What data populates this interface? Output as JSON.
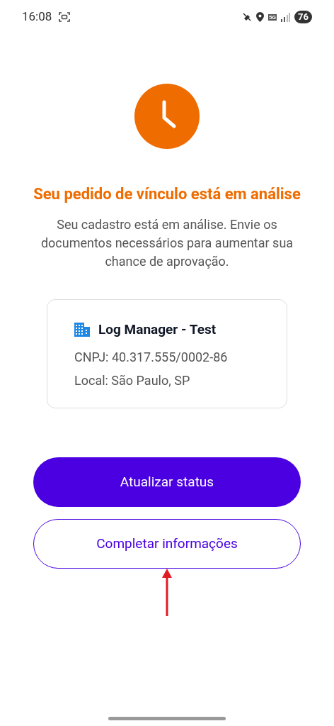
{
  "status_bar": {
    "time": "16:08",
    "battery": "76",
    "network": "5G"
  },
  "title": "Seu pedido de vínculo está em análise",
  "description": "Seu cadastro está em análise. Envie os documentos necessários para aumentar sua chance de aprovação.",
  "company": {
    "name": "Log Manager - Test",
    "cnpj": "CNPJ: 40.317.555/0002-86",
    "location": "Local: São Paulo, SP"
  },
  "buttons": [
    {
      "label": "Atualizar status",
      "kind": "primary"
    },
    {
      "label": "Completar informações",
      "kind": "outline"
    }
  ]
}
